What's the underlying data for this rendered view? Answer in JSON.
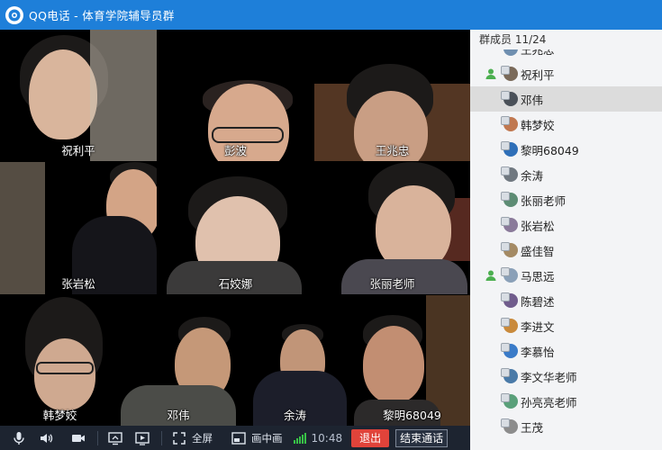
{
  "window": {
    "title": "QQ电话 - 体育学院辅导员群"
  },
  "participants": [
    {
      "name": "祝利平",
      "bg": "#6b5a48"
    },
    {
      "name": "彭波",
      "bg": "#a88470"
    },
    {
      "name": "王兆忠",
      "bg": "#e3ddd2"
    },
    {
      "name": "张岩松",
      "bg": "#bfb8ae"
    },
    {
      "name": "石姣娜",
      "bg": "#f1ede8"
    },
    {
      "name": "张丽老师",
      "bg": "#d9d2c6"
    },
    {
      "name": "韩梦姣",
      "bg": "#c9c5c0"
    },
    {
      "name": "邓伟",
      "bg": "#b9b2aa"
    },
    {
      "name": "余涛",
      "bg": "#cfc8c1"
    },
    {
      "name": "黎明68049",
      "bg": "#8f6d4e"
    }
  ],
  "toolbar": {
    "fullscreen_label": "全屏",
    "pip_label": "画中画",
    "time": "10:48",
    "exit_label": "退出",
    "end_label": "结束通话"
  },
  "members": {
    "header": "群成员 11/24",
    "list": [
      {
        "name": "王兆忠",
        "host": false,
        "selected": false
      },
      {
        "name": "祝利平",
        "host": true,
        "selected": false
      },
      {
        "name": "邓伟",
        "host": false,
        "selected": true
      },
      {
        "name": "韩梦姣",
        "host": false,
        "selected": false
      },
      {
        "name": "黎明68049",
        "host": false,
        "selected": false
      },
      {
        "name": "余涛",
        "host": false,
        "selected": false
      },
      {
        "name": "张丽老师",
        "host": false,
        "selected": false
      },
      {
        "name": "张岩松",
        "host": false,
        "selected": false
      },
      {
        "name": "盛佳智",
        "host": false,
        "selected": false
      },
      {
        "name": "马思远",
        "host": true,
        "selected": false
      },
      {
        "name": "陈碧述",
        "host": false,
        "selected": false
      },
      {
        "name": "李进文",
        "host": false,
        "selected": false
      },
      {
        "name": "李慕怡",
        "host": false,
        "selected": false
      },
      {
        "name": "李文华老师",
        "host": false,
        "selected": false
      },
      {
        "name": "孙亮亮老师",
        "host": false,
        "selected": false
      },
      {
        "name": "王茂",
        "host": false,
        "selected": false
      }
    ]
  },
  "colors": {
    "titlebar": "#1e7fd9",
    "toolbar": "#1d2430",
    "exit": "#e0433a",
    "signal": "#38c247"
  }
}
